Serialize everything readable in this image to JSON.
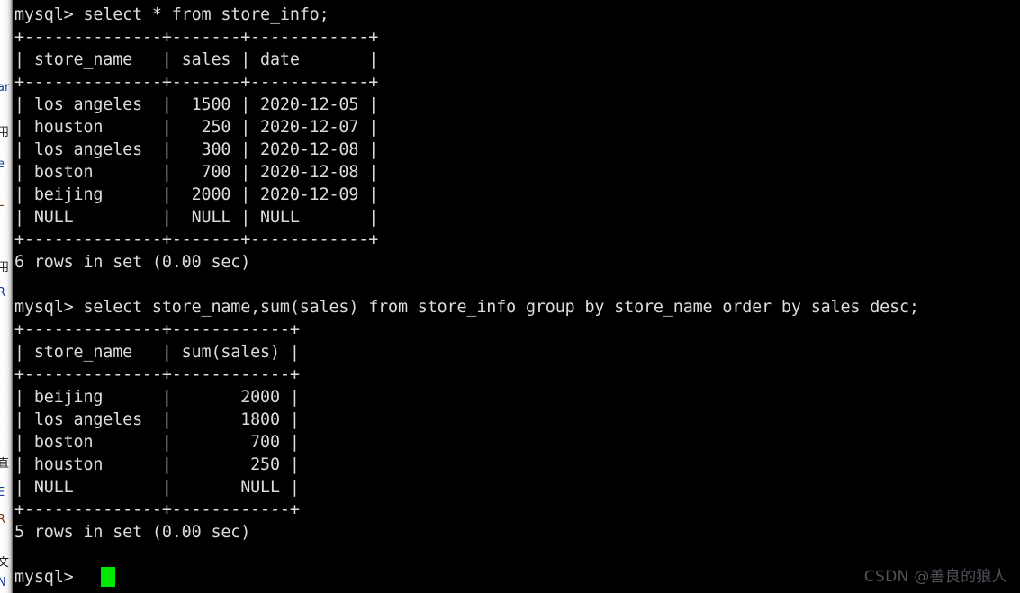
{
  "terminal": {
    "prompt": "mysql>",
    "cursor_color": "#00e800",
    "text_color": "#dcdcdc",
    "background_color": "#000000",
    "session_text": "mysql> select * from store_info;\n+--------------+-------+------------+\n| store_name   | sales | date       |\n+--------------+-------+------------+\n| los angeles  |  1500 | 2020-12-05 |\n| houston      |   250 | 2020-12-07 |\n| los angeles  |   300 | 2020-12-08 |\n| boston       |   700 | 2020-12-08 |\n| beijing      |  2000 | 2020-12-09 |\n| NULL         |  NULL | NULL       |\n+--------------+-------+------------+\n6 rows in set (0.00 sec)\n\nmysql> select store_name,sum(sales) from store_info group by store_name order by sales desc;\n+--------------+------------+\n| store_name   | sum(sales) |\n+--------------+------------+\n| beijing      |       2000 |\n| los angeles  |       1800 |\n| boston       |        700 |\n| houston      |        250 |\n| NULL         |       NULL |\n+--------------+------------+\n5 rows in set (0.00 sec)\n\nmysql> ",
    "commands": [
      {
        "index": 1,
        "prompt": "mysql>",
        "sql": "select * from store_info;",
        "result_status": "6 rows in set (0.00 sec)",
        "table": {
          "columns": [
            "store_name",
            "sales",
            "date"
          ],
          "rows": [
            [
              "los angeles",
              "1500",
              "2020-12-05"
            ],
            [
              "houston",
              "250",
              "2020-12-07"
            ],
            [
              "los angeles",
              "300",
              "2020-12-08"
            ],
            [
              "boston",
              "700",
              "2020-12-08"
            ],
            [
              "beijing",
              "2000",
              "2020-12-09"
            ],
            [
              "NULL",
              "NULL",
              "NULL"
            ]
          ]
        }
      },
      {
        "index": 2,
        "prompt": "mysql>",
        "sql": "select store_name,sum(sales) from store_info group by store_name order by sales desc;",
        "result_status": "5 rows in set (0.00 sec)",
        "table": {
          "columns": [
            "store_name",
            "sum(sales)"
          ],
          "rows": [
            [
              "beijing",
              "2000"
            ],
            [
              "los angeles",
              "1800"
            ],
            [
              "boston",
              "700"
            ],
            [
              "houston",
              "250"
            ],
            [
              "NULL",
              "NULL"
            ]
          ]
        }
      }
    ]
  },
  "background_strip": {
    "fragments": [
      "ar",
      "用",
      "e",
      "L",
      "R",
      "用",
      "直",
      "E",
      "R",
      "文",
      "N"
    ]
  },
  "watermark": {
    "text": "CSDN @善良的狼人"
  }
}
